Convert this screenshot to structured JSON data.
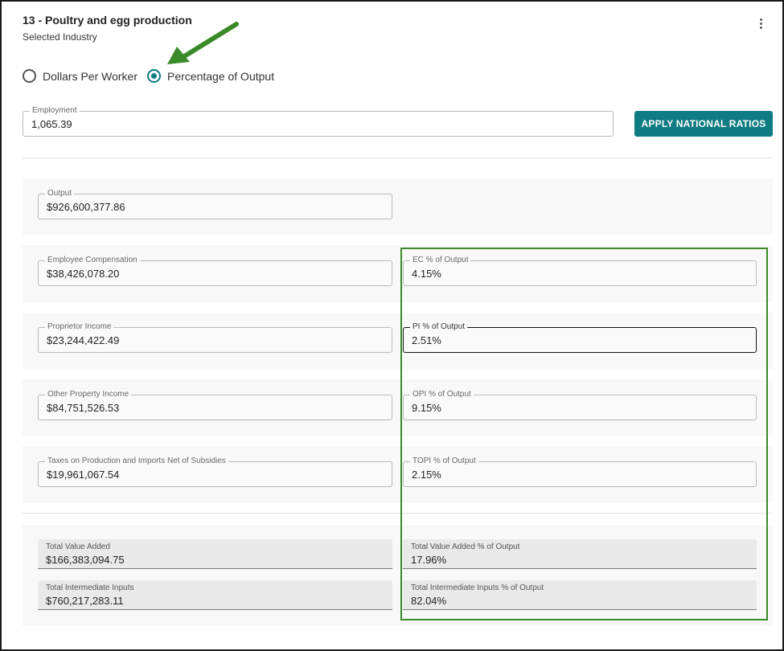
{
  "header": {
    "title": "13 - Poultry and egg production",
    "subtitle": "Selected Industry"
  },
  "mode": {
    "options": [
      {
        "label": "Dollars Per Worker",
        "selected": false
      },
      {
        "label": "Percentage of Output",
        "selected": true
      }
    ]
  },
  "employment": {
    "label": "Employment",
    "value": "1,065.39"
  },
  "apply_button": {
    "label": "APPLY NATIONAL RATIOS"
  },
  "output": {
    "label": "Output",
    "value": "$926,600,377.86"
  },
  "rows": [
    {
      "left_label": "Employee Compensation",
      "left_value": "$38,426,078.20",
      "right_label": "EC % of Output",
      "right_value": "4.15%"
    },
    {
      "left_label": "Proprietor Income",
      "left_value": "$23,244,422.49",
      "right_label": "PI % of Output",
      "right_value": "2.51%"
    },
    {
      "left_label": "Other Property Income",
      "left_value": "$84,751,526.53",
      "right_label": "OPI % of Output",
      "right_value": "9.15%"
    },
    {
      "left_label": "Taxes on Production and Imports Net of Subsidies",
      "left_value": "$19,961,067.54",
      "right_label": "TOPI % of Output",
      "right_value": "2.15%"
    }
  ],
  "totals": [
    {
      "left_label": "Total Value Added",
      "left_value": "$166,383,094.75",
      "right_label": "Total Value Added % of Output",
      "right_value": "17.96%"
    },
    {
      "left_label": "Total Intermediate Inputs",
      "left_value": "$760,217,283.11",
      "right_label": "Total Intermediate Inputs % of Output",
      "right_value": "82.04%"
    }
  ],
  "colors": {
    "accent": "#0f7b83",
    "highlight": "#3a8a2a"
  }
}
